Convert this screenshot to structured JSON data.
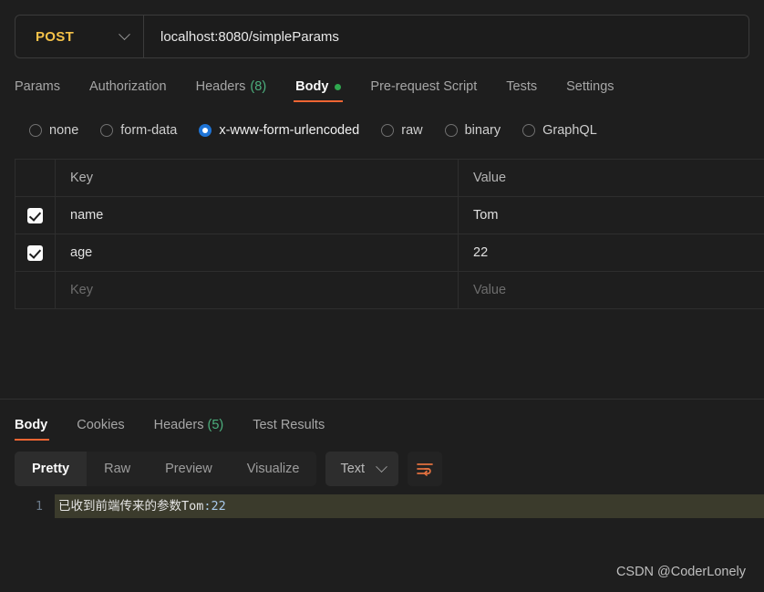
{
  "request": {
    "method": "POST",
    "url": "localhost:8080/simpleParams",
    "tabs": [
      {
        "label": "Params",
        "active": false,
        "count": "",
        "dot": false
      },
      {
        "label": "Authorization",
        "active": false,
        "count": "",
        "dot": false
      },
      {
        "label": "Headers",
        "active": false,
        "count": "(8)",
        "dot": false
      },
      {
        "label": "Body",
        "active": true,
        "count": "",
        "dot": true
      },
      {
        "label": "Pre-request Script",
        "active": false,
        "count": "",
        "dot": false
      },
      {
        "label": "Tests",
        "active": false,
        "count": "",
        "dot": false
      },
      {
        "label": "Settings",
        "active": false,
        "count": "",
        "dot": false
      }
    ],
    "body_types": [
      {
        "label": "none",
        "selected": false
      },
      {
        "label": "form-data",
        "selected": false
      },
      {
        "label": "x-www-form-urlencoded",
        "selected": true
      },
      {
        "label": "raw",
        "selected": false
      },
      {
        "label": "binary",
        "selected": false
      },
      {
        "label": "GraphQL",
        "selected": false
      }
    ],
    "table": {
      "headers": {
        "key": "Key",
        "value": "Value"
      },
      "rows": [
        {
          "checked": true,
          "key": "name",
          "value": "Tom"
        },
        {
          "checked": true,
          "key": "age",
          "value": "22"
        }
      ],
      "placeholder_row": {
        "key": "Key",
        "value": "Value"
      }
    }
  },
  "response": {
    "tabs": [
      {
        "label": "Body",
        "active": true,
        "count": ""
      },
      {
        "label": "Cookies",
        "active": false,
        "count": ""
      },
      {
        "label": "Headers",
        "active": false,
        "count": "(5)"
      },
      {
        "label": "Test Results",
        "active": false,
        "count": ""
      }
    ],
    "view_modes": [
      {
        "label": "Pretty",
        "active": true
      },
      {
        "label": "Raw",
        "active": false
      },
      {
        "label": "Preview",
        "active": false
      },
      {
        "label": "Visualize",
        "active": false
      }
    ],
    "format_selected": "Text",
    "body": {
      "line_number": "1",
      "text_cn": "已收到前端传来的参数",
      "text_name": "Tom",
      "text_sep": ":",
      "text_num": "22"
    }
  },
  "watermark": "CSDN @CoderLonely",
  "colors": {
    "accent": "#f06533",
    "method": "#f5c249",
    "count": "#4caf7d",
    "radio_selected": "#1e74d6",
    "highlight": "#3b3b2c"
  }
}
